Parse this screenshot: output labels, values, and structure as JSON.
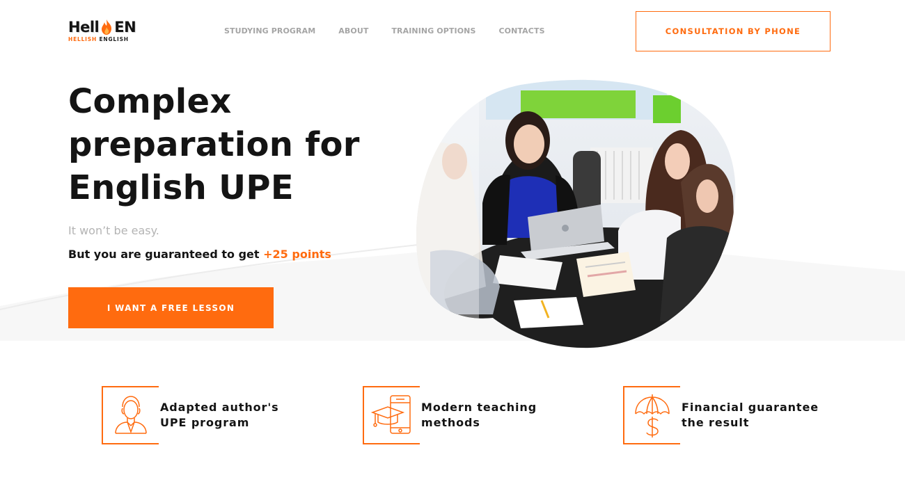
{
  "logo": {
    "main_left": "Hell",
    "main_right": "EN",
    "sub_highlight": "HELLISH",
    "sub_rest": "ENGLISH",
    "brand_color": "#ff6b0f"
  },
  "nav": [
    {
      "label": "STUDYING PROGRAM"
    },
    {
      "label": "ABOUT"
    },
    {
      "label": "TRAINING OPTIONS"
    },
    {
      "label": "CONTACTS"
    }
  ],
  "header": {
    "consult_label": "CONSULTATION BY PHONE"
  },
  "hero": {
    "title": "Complex preparation for English UPE",
    "subtitle": "It won’t be easy.",
    "guarantee_text": "But you are guaranteed to get",
    "guarantee_accent": "+25 points",
    "cta_label": "I WANT A FREE LESSON"
  },
  "features": [
    {
      "line1": "Adapted author's",
      "line2": "UPE program",
      "icon": "teacher-icon"
    },
    {
      "line1": "Modern teaching",
      "line2": "methods",
      "icon": "phone-graduation-cap-icon"
    },
    {
      "line1": "Financial guarantee",
      "line2": "the result",
      "icon": "umbrella-dollar-icon"
    }
  ],
  "colors": {
    "accent": "#ff6b0f",
    "text": "#141414",
    "muted": "#a5a5a5"
  }
}
